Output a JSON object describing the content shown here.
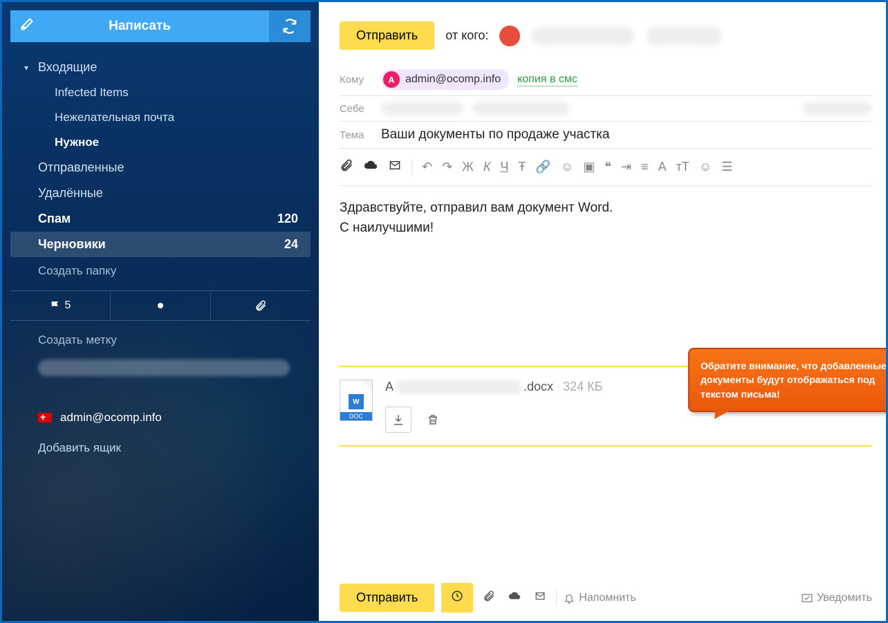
{
  "sidebar": {
    "compose_label": "Написать",
    "folders": [
      {
        "label": "Входящие",
        "count": "",
        "inbox": true
      },
      {
        "label": "Infected Items",
        "count": "",
        "sub": true
      },
      {
        "label": "Нежелательная почта",
        "count": "",
        "sub": true
      },
      {
        "label": "Нужное",
        "count": "",
        "sub": true,
        "bold": true
      },
      {
        "label": "Отправленные",
        "count": ""
      },
      {
        "label": "Удалённые",
        "count": ""
      },
      {
        "label": "Спам",
        "count": "120"
      },
      {
        "label": "Черновики",
        "count": "24",
        "active": true
      }
    ],
    "create_folder": "Создать папку",
    "flag_count": "5",
    "create_label": "Создать метку",
    "account_email": "admin@ocomp.info",
    "add_mailbox": "Добавить ящик"
  },
  "compose": {
    "send_label": "Отправить",
    "from_label": "от кого:",
    "to_label": "Кому",
    "to_chip_letter": "А",
    "to_chip_email": "admin@ocomp.info",
    "sms_link": "копия в смс",
    "self_label": "Себе",
    "subject_label": "Тема",
    "subject_value": "Ваши документы по продаже участка",
    "body_line1": "Здравствуйте, отправил вам документ Word.",
    "body_line2": "С наилучшими!",
    "callout_text": "Обратите внимание, что добавленные документы будут отображаться под текстом письма!",
    "attachment": {
      "name_prefix": "А",
      "name_suffix": ".docx",
      "size": "324 КБ",
      "ext_label": "DOC",
      "w_label": "W"
    },
    "bottom": {
      "send": "Отправить",
      "remind": "Напомнить",
      "notify": "Уведомить"
    }
  }
}
